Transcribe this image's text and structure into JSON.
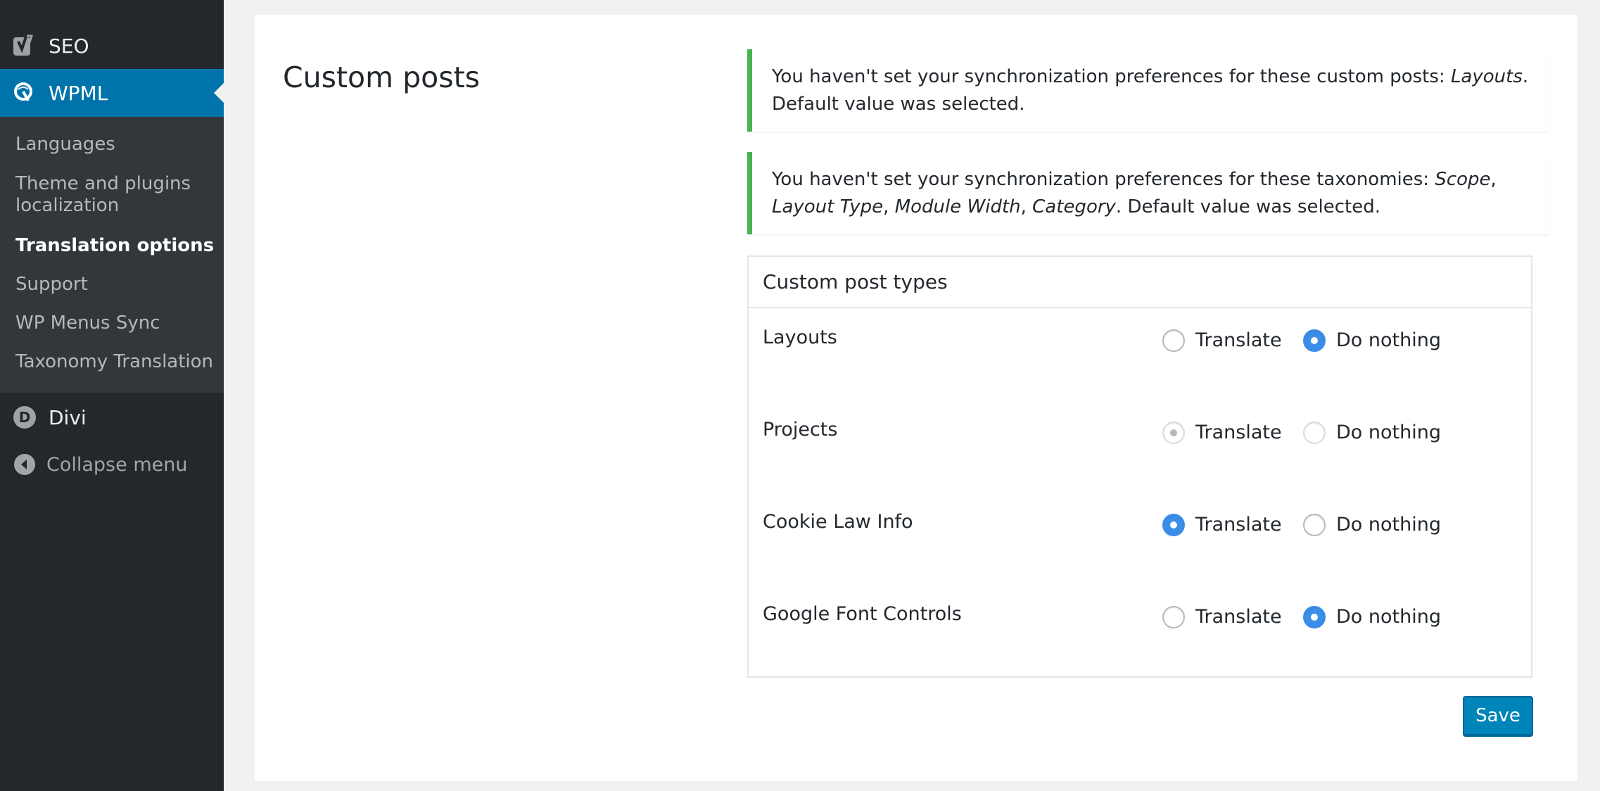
{
  "sidebar": {
    "seo_label": "SEO",
    "wpml_label": "WPML",
    "submenu": [
      {
        "label": "Languages",
        "current": false
      },
      {
        "label": "Theme and plugins localization",
        "current": false
      },
      {
        "label": "Translation options",
        "current": true
      },
      {
        "label": "Support",
        "current": false
      },
      {
        "label": "WP Menus Sync",
        "current": false
      },
      {
        "label": "Taxonomy Translation",
        "current": false
      }
    ],
    "divi_label": "Divi",
    "divi_icon_letter": "D",
    "collapse_label": "Collapse menu"
  },
  "main": {
    "section_title": "Custom posts",
    "notices": [
      {
        "prefix": "You haven't set your synchronization preferences for these custom posts: ",
        "items": [
          "Layouts"
        ],
        "suffix": ". Default value was selected."
      },
      {
        "prefix": "You haven't set your synchronization preferences for these taxonomies: ",
        "items": [
          "Scope",
          "Layout Type",
          "Module Width",
          "Category"
        ],
        "suffix": ". Default value was selected."
      }
    ],
    "box_title": "Custom post types",
    "option_translate": "Translate",
    "option_do_nothing": "Do nothing",
    "post_types": [
      {
        "name": "Layouts",
        "selected": "do_nothing",
        "disabled": false
      },
      {
        "name": "Projects",
        "selected": "translate",
        "disabled": true
      },
      {
        "name": "Cookie Law Info",
        "selected": "translate",
        "disabled": false
      },
      {
        "name": "Google Font Controls",
        "selected": "do_nothing",
        "disabled": false
      }
    ],
    "save_label": "Save"
  },
  "colors": {
    "sidebar_bg": "#23282d",
    "active_menu": "#0073aa",
    "notice_border": "#46b450",
    "radio_checked": "#3b8ee8",
    "button_primary": "#0085ba"
  }
}
